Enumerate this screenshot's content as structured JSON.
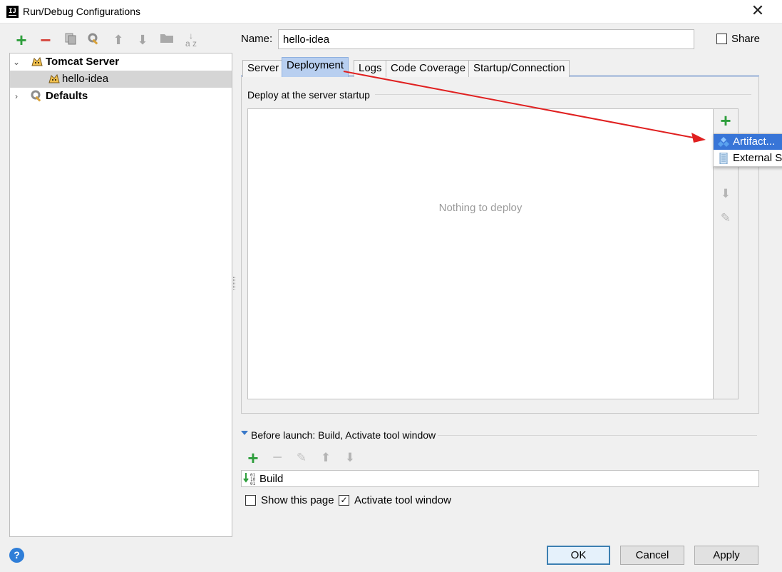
{
  "window": {
    "title": "Run/Debug Configurations",
    "app_icon": "IJ",
    "close_glyph": "✕"
  },
  "left_toolbar": {
    "icons": [
      "add-icon",
      "remove-icon",
      "copy-icon",
      "edit-defaults-icon",
      "move-up-icon",
      "move-down-icon",
      "folder-icon",
      "sort-icon"
    ]
  },
  "tree": {
    "items": [
      {
        "label": "Tomcat Server",
        "expanded": true,
        "icon": "tomcat-icon"
      },
      {
        "label": "hello-idea",
        "selected": true,
        "icon": "tomcat-icon"
      },
      {
        "label": "Defaults",
        "expanded": false,
        "icon": "defaults-icon"
      }
    ]
  },
  "name_field": {
    "label": "Name:",
    "value": "hello-idea"
  },
  "share": {
    "label": "Share",
    "checked": false
  },
  "tabs": [
    {
      "label": "Server",
      "active": false
    },
    {
      "label": "Deployment",
      "active": true
    },
    {
      "label": "Logs",
      "active": false
    },
    {
      "label": "Code Coverage",
      "active": false
    },
    {
      "label": "Startup/Connection",
      "active": false
    }
  ],
  "deployment": {
    "header": "Deploy at the server startup",
    "empty_text": "Nothing to deploy"
  },
  "popup_menu": {
    "items": [
      {
        "label": "Artifact...",
        "selected": true,
        "icon": "artifact-icon"
      },
      {
        "label": "External Source...",
        "selected": false,
        "icon": "external-source-icon"
      }
    ]
  },
  "before_launch": {
    "label": "Before launch: Build, Activate tool window",
    "tasks": [
      {
        "label": "Build",
        "icon": "build-icon"
      }
    ]
  },
  "options": {
    "show_this_page": {
      "label": "Show this page",
      "checked": false
    },
    "activate_tool_window": {
      "label": "Activate tool window",
      "checked": true
    }
  },
  "buttons": {
    "ok": "OK",
    "cancel": "Cancel",
    "apply": "Apply",
    "help": "?"
  },
  "colors": {
    "accent_tab": "#b8cff0",
    "selection": "#3875d7",
    "annotation_arrow": "#e02020",
    "green": "#2e9e3c",
    "red": "#d6453c"
  }
}
